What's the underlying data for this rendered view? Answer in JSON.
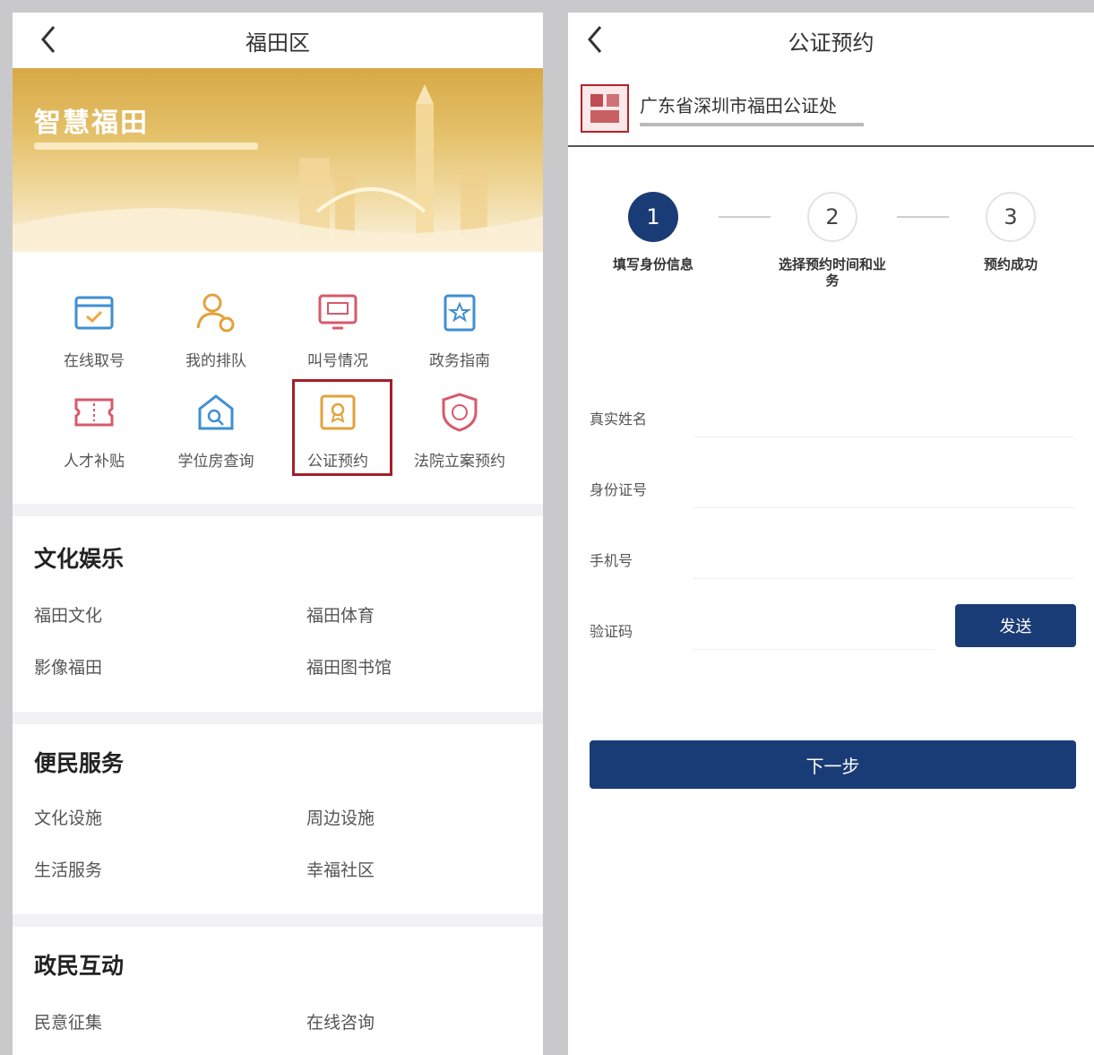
{
  "left": {
    "nav_title": "福田区",
    "banner": {
      "title": "智慧福田"
    },
    "grid": [
      {
        "label": "在线取号",
        "icon": "calendar-check-icon"
      },
      {
        "label": "我的排队",
        "icon": "user-queue-icon"
      },
      {
        "label": "叫号情况",
        "icon": "monitor-icon"
      },
      {
        "label": "政务指南",
        "icon": "book-icon"
      },
      {
        "label": "人才补贴",
        "icon": "ticket-icon"
      },
      {
        "label": "学位房查询",
        "icon": "house-search-icon"
      },
      {
        "label": "公证预约",
        "icon": "certificate-icon",
        "highlighted": true
      },
      {
        "label": "法院立案预约",
        "icon": "shield-icon"
      }
    ],
    "sections": [
      {
        "title": "文化娱乐",
        "links": [
          "福田文化",
          "福田体育",
          "影像福田",
          "福田图书馆"
        ]
      },
      {
        "title": "便民服务",
        "links": [
          "文化设施",
          "周边设施",
          "生活服务",
          "幸福社区"
        ]
      },
      {
        "title": "政民互动",
        "links": [
          "民意征集",
          "在线咨询"
        ]
      }
    ]
  },
  "right": {
    "nav_title": "公证预约",
    "org_name": "广东省深圳市福田公证处",
    "steps": [
      {
        "number": "1",
        "label": "填写身份信息",
        "state": "active"
      },
      {
        "number": "2",
        "label": "选择预约时间和业务",
        "state": "todo"
      },
      {
        "number": "3",
        "label": "预约成功",
        "state": "todo"
      }
    ],
    "form": {
      "name_label": "真实姓名",
      "id_label": "身份证号",
      "phone_label": "手机号",
      "code_label": "验证码",
      "send_label": "发送"
    },
    "next_label": "下一步"
  },
  "colors": {
    "primary": "#1a3c76",
    "highlight": "#a31f2a",
    "banner": "#d7a945"
  }
}
